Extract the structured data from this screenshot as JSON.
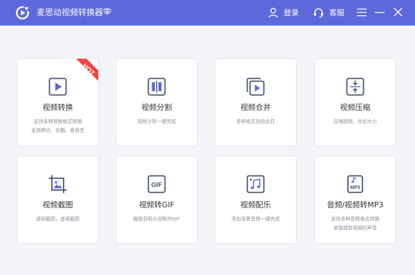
{
  "app": {
    "title": "麦思动视频转换器"
  },
  "header": {
    "login_label": "登录",
    "service_label": "客服"
  },
  "badge": {
    "hot": "HOT"
  },
  "colors": {
    "accent": "#5d69db",
    "hot": "#f2453d",
    "icon": "#4a5370"
  },
  "cards": [
    {
      "title": "视频转换",
      "desc1": "支持多种视频格式转换",
      "desc2": "支持腾讯、优酷、爱奇艺",
      "icon": "play-icon"
    },
    {
      "title": "视频分割",
      "desc1": "视频分割一键完成",
      "desc2": "",
      "icon": "split-icon"
    },
    {
      "title": "视频合并",
      "desc1": "多种格式自由合并",
      "desc2": "",
      "icon": "merge-icon"
    },
    {
      "title": "视频压缩",
      "desc1": "压缩视频，优化大小",
      "desc2": "",
      "icon": "compress-icon"
    },
    {
      "title": "视频截图",
      "desc1": "逐帧截图，连续截图",
      "desc2": "",
      "icon": "screenshot-icon"
    },
    {
      "title": "视频转GIF",
      "desc1": "截取目标片段制作GIF",
      "desc2": "",
      "icon": "gif-icon",
      "icon_text": "GIF"
    },
    {
      "title": "视频配乐",
      "desc1": "添加背景音频一键完成",
      "desc2": "",
      "icon": "music-icon"
    },
    {
      "title": "音频/视频转MP3",
      "desc1": "支持多种音频格式转换",
      "desc2": "单独提取视频的声音",
      "icon": "mp3-icon",
      "icon_text": "MP3"
    }
  ]
}
